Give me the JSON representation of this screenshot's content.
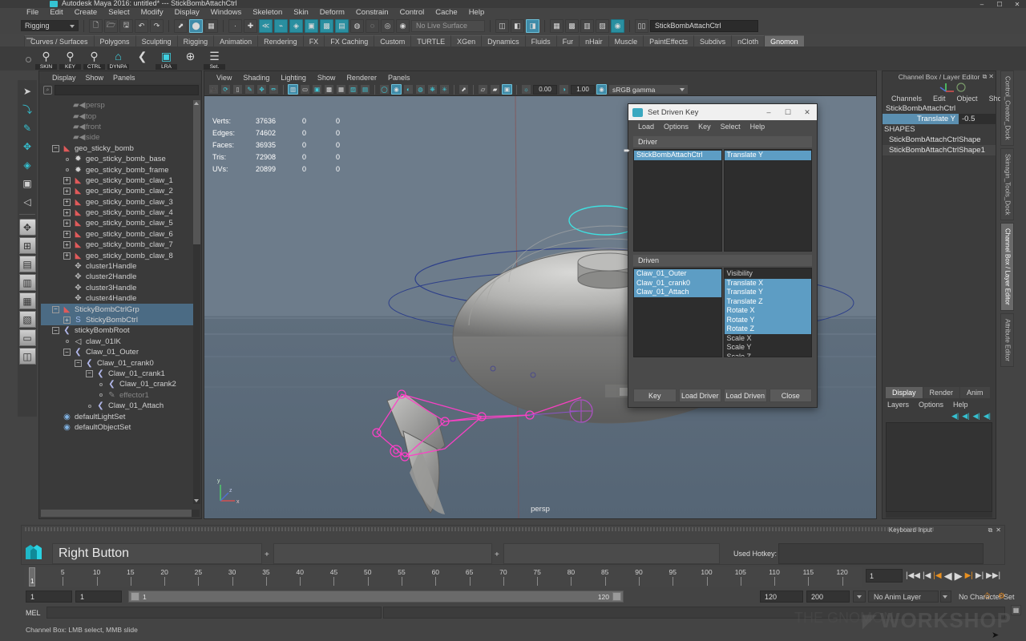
{
  "titlebar": {
    "title": "Autodesk Maya 2016: untitled* --- StickBombAttachCtrl",
    "minimize": "–",
    "maximize": "☐",
    "close": "✕"
  },
  "menubar": {
    "items": [
      "File",
      "Edit",
      "Create",
      "Select",
      "Modify",
      "Display",
      "Windows",
      "Skeleton",
      "Skin",
      "Deform",
      "Constrain",
      "Control",
      "Cache",
      "Help"
    ]
  },
  "statusline": {
    "menuset": "Rigging",
    "live_surface": "No Live Surface",
    "selected_name": "StickBombAttachCtrl",
    "icons": [
      "new-file-icon",
      "open-file-icon",
      "save-file-icon",
      "undo-icon",
      "redo-icon",
      "select-hierarchy-icon",
      "select-object-icon",
      "select-component-icon",
      "snap-grid-icon",
      "snap-curve-icon",
      "snap-point-icon",
      "snap-view-plane-icon",
      "construction-history-icon",
      "render-current-frame-icon",
      "render-sequence-icon",
      "ipr-render-icon",
      "render-settings-icon",
      "hypershade-icon",
      "show-channelbox-icon"
    ]
  },
  "shelf": {
    "tabs": [
      "Curves / Surfaces",
      "Polygons",
      "Sculpting",
      "Rigging",
      "Animation",
      "Rendering",
      "FX",
      "FX Caching",
      "Custom",
      "TURTLE",
      "XGen",
      "Dynamics",
      "Fluids",
      "Fur",
      "nHair",
      "Muscle",
      "PaintEffects",
      "Subdivs",
      "nCloth",
      "Gnomon"
    ],
    "active_tab": "Gnomon",
    "buttons": [
      {
        "label": "SKIN",
        "icon": "skin-tool-icon"
      },
      {
        "label": "KEY",
        "icon": "key-tool-icon"
      },
      {
        "label": "CTRL",
        "icon": "ctrl-tool-icon"
      },
      {
        "label": "DYNPA",
        "icon": "dynpa-tool-icon"
      },
      {
        "label": "",
        "icon": "joint-tool-icon"
      },
      {
        "label": "LRA",
        "icon": "lra-toggle-icon"
      },
      {
        "label": "",
        "icon": "move-pivot-icon"
      },
      {
        "label": "Set.",
        "icon": "settings-tool-icon"
      }
    ]
  },
  "toolbox": {
    "tools": [
      {
        "name": "select-tool",
        "glyph": "➤"
      },
      {
        "name": "lasso-select-tool",
        "glyph": "⤵"
      },
      {
        "name": "paint-select-tool",
        "glyph": "✎"
      },
      {
        "name": "move-tool",
        "glyph": "✥"
      },
      {
        "name": "rotate-tool",
        "glyph": "◈"
      },
      {
        "name": "scale-tool",
        "glyph": "▣"
      },
      {
        "name": "show-manipulator-tool",
        "glyph": "◁"
      }
    ],
    "layouts": [
      {
        "name": "single-perspective-layout",
        "glyph": "✥"
      },
      {
        "name": "four-view-layout",
        "glyph": "⊞"
      },
      {
        "name": "persp-outliner-layout",
        "glyph": "▤"
      },
      {
        "name": "two-pane-side-layout",
        "glyph": "▥"
      },
      {
        "name": "persp-graph-layout",
        "glyph": "▦"
      },
      {
        "name": "hypershade-persp-layout",
        "glyph": "▧"
      },
      {
        "name": "persp-render-layout",
        "glyph": "▭"
      },
      {
        "name": "outliner-persp-layout",
        "glyph": "◫"
      }
    ]
  },
  "outliner": {
    "menu": [
      "Display",
      "Show",
      "Panels"
    ],
    "search_placeholder": "",
    "search_value": "",
    "search_icon": "filter-icon",
    "items": [
      {
        "label": "persp",
        "indent": 2,
        "expander": "none",
        "icon": "camera-icon",
        "dim": true,
        "selected": false
      },
      {
        "label": "top",
        "indent": 2,
        "expander": "none",
        "icon": "camera-icon",
        "dim": true,
        "selected": false
      },
      {
        "label": "front",
        "indent": 2,
        "expander": "none",
        "icon": "camera-icon",
        "dim": true,
        "selected": false
      },
      {
        "label": "side",
        "indent": 2,
        "expander": "none",
        "icon": "camera-icon",
        "dim": true,
        "selected": false
      },
      {
        "label": "geo_sticky_bomb",
        "indent": 1,
        "expander": "minus",
        "icon": "mesh-icon",
        "dim": false,
        "selected": false
      },
      {
        "label": "geo_sticky_bomb_base",
        "indent": 2,
        "expander": "nub",
        "icon": "shape-icon",
        "dim": false,
        "selected": false
      },
      {
        "label": "geo_sticky_bomb_frame",
        "indent": 2,
        "expander": "nub",
        "icon": "shape-icon",
        "dim": false,
        "selected": false
      },
      {
        "label": "geo_sticky_bomb_claw_1",
        "indent": 2,
        "expander": "plus",
        "icon": "mesh-icon",
        "dim": false,
        "selected": false
      },
      {
        "label": "geo_sticky_bomb_claw_2",
        "indent": 2,
        "expander": "plus",
        "icon": "mesh-icon",
        "dim": false,
        "selected": false
      },
      {
        "label": "geo_sticky_bomb_claw_3",
        "indent": 2,
        "expander": "plus",
        "icon": "mesh-icon",
        "dim": false,
        "selected": false
      },
      {
        "label": "geo_sticky_bomb_claw_4",
        "indent": 2,
        "expander": "plus",
        "icon": "mesh-icon",
        "dim": false,
        "selected": false
      },
      {
        "label": "geo_sticky_bomb_claw_5",
        "indent": 2,
        "expander": "plus",
        "icon": "mesh-icon",
        "dim": false,
        "selected": false
      },
      {
        "label": "geo_sticky_bomb_claw_6",
        "indent": 2,
        "expander": "plus",
        "icon": "mesh-icon",
        "dim": false,
        "selected": false
      },
      {
        "label": "geo_sticky_bomb_claw_7",
        "indent": 2,
        "expander": "plus",
        "icon": "mesh-icon",
        "dim": false,
        "selected": false
      },
      {
        "label": "geo_sticky_bomb_claw_8",
        "indent": 2,
        "expander": "plus",
        "icon": "mesh-icon",
        "dim": false,
        "selected": false
      },
      {
        "label": "cluster1Handle",
        "indent": 2,
        "expander": "none",
        "icon": "cluster-icon",
        "dim": false,
        "selected": false
      },
      {
        "label": "cluster2Handle",
        "indent": 2,
        "expander": "none",
        "icon": "cluster-icon",
        "dim": false,
        "selected": false
      },
      {
        "label": "cluster3Handle",
        "indent": 2,
        "expander": "none",
        "icon": "cluster-icon",
        "dim": false,
        "selected": false
      },
      {
        "label": "cluster4Handle",
        "indent": 2,
        "expander": "none",
        "icon": "cluster-icon",
        "dim": false,
        "selected": false
      },
      {
        "label": "StickyBombCtrlGrp",
        "indent": 1,
        "expander": "minus",
        "icon": "mesh-icon",
        "dim": false,
        "selected": true
      },
      {
        "label": "StickyBombCtrl",
        "indent": 2,
        "expander": "plus",
        "icon": "curve-icon",
        "dim": false,
        "selected": true
      },
      {
        "label": "stickyBombRoot",
        "indent": 1,
        "expander": "minus",
        "icon": "joint-icon",
        "dim": false,
        "selected": false
      },
      {
        "label": "claw_01IK",
        "indent": 2,
        "expander": "nub",
        "icon": "ik-icon",
        "dim": false,
        "selected": false
      },
      {
        "label": "Claw_01_Outer",
        "indent": 2,
        "expander": "minus",
        "icon": "joint-icon",
        "dim": false,
        "selected": false
      },
      {
        "label": "Claw_01_crank0",
        "indent": 3,
        "expander": "minus",
        "icon": "joint-icon",
        "dim": false,
        "selected": false
      },
      {
        "label": "Claw_01_crank1",
        "indent": 4,
        "expander": "minus",
        "icon": "joint-icon",
        "dim": false,
        "selected": false
      },
      {
        "label": "Claw_01_crank2",
        "indent": 5,
        "expander": "nub",
        "icon": "joint-icon",
        "dim": false,
        "selected": false
      },
      {
        "label": "effector1",
        "indent": 5,
        "expander": "nub",
        "icon": "effector-icon",
        "dim": true,
        "selected": false
      },
      {
        "label": "Claw_01_Attach",
        "indent": 4,
        "expander": "nub",
        "icon": "joint-icon",
        "dim": false,
        "selected": false
      },
      {
        "label": "defaultLightSet",
        "indent": 1,
        "expander": "none",
        "icon": "set-icon",
        "dim": false,
        "selected": false
      },
      {
        "label": "defaultObjectSet",
        "indent": 1,
        "expander": "none",
        "icon": "set-icon",
        "dim": false,
        "selected": false
      }
    ]
  },
  "viewport": {
    "menu": [
      "View",
      "Shading",
      "Lighting",
      "Show",
      "Renderer",
      "Panels"
    ],
    "camera_label": "persp",
    "exposure": "0.00",
    "gamma": "1.00",
    "color_space": "sRGB gamma",
    "hud": {
      "rows": [
        {
          "label": "Verts:",
          "total": "37636",
          "col2": "0",
          "col3": "0"
        },
        {
          "label": "Edges:",
          "total": "74602",
          "col2": "0",
          "col3": "0"
        },
        {
          "label": "Faces:",
          "total": "36935",
          "col2": "0",
          "col3": "0"
        },
        {
          "label": "Tris:",
          "total": "72908",
          "col2": "0",
          "col3": "0"
        },
        {
          "label": "UVs:",
          "total": "20899",
          "col2": "0",
          "col3": "0"
        }
      ]
    },
    "axis_labels": {
      "x": "x",
      "y": "y",
      "z": "z"
    }
  },
  "set_driven_key": {
    "title": "Set Driven Key",
    "window_icon": "maya-window-icon",
    "minimize": "–",
    "maximize": "☐",
    "close": "✕",
    "menu": [
      "Load",
      "Options",
      "Key",
      "Select",
      "Help"
    ],
    "driver_section": "Driver",
    "driven_section": "Driven",
    "driver_objects": [
      {
        "label": "StickBombAttachCtrl",
        "selected": true
      }
    ],
    "driver_attrs": [
      {
        "label": "Translate Y",
        "selected": true
      }
    ],
    "driven_objects": [
      {
        "label": "Claw_01_Outer",
        "selected": true
      },
      {
        "label": "Claw_01_crank0",
        "selected": true
      },
      {
        "label": "Claw_01_Attach",
        "selected": true
      }
    ],
    "driven_attrs": [
      {
        "label": "Visibility",
        "selected": false
      },
      {
        "label": "Translate X",
        "selected": true
      },
      {
        "label": "Translate Y",
        "selected": true
      },
      {
        "label": "Translate Z",
        "selected": true
      },
      {
        "label": "Rotate X",
        "selected": true
      },
      {
        "label": "Rotate Y",
        "selected": true
      },
      {
        "label": "Rotate Z",
        "selected": true
      },
      {
        "label": "Scale X",
        "selected": false
      },
      {
        "label": "Scale Y",
        "selected": false
      },
      {
        "label": "Scale Z",
        "selected": false
      }
    ],
    "buttons": [
      "Key",
      "Load Driver",
      "Load Driven",
      "Close"
    ]
  },
  "channel_box": {
    "panel_title": "Channel Box / Layer Editor",
    "menu": [
      "Channels",
      "Edit",
      "Object",
      "Show"
    ],
    "object_name": "StickBombAttachCtrl",
    "channels": [
      {
        "attr": "Translate Y",
        "value": "-0.5"
      }
    ],
    "shapes_header": "SHAPES",
    "shapes": [
      "StickBombAttachCtrlShape",
      "StickBombAttachCtrlShape1"
    ],
    "layer_tabs": [
      "Display",
      "Render",
      "Anim"
    ],
    "active_layer_tab": "Display",
    "layer_menu": [
      "Layers",
      "Options",
      "Help"
    ],
    "layer_icons": [
      "layer-prev-icon",
      "layer-prev-fast-icon",
      "layer-next-icon",
      "layer-next-fast-icon"
    ]
  },
  "dock_tabs": {
    "items": [
      "Control_Creator_Dock",
      "Skinagin_Tools_Dock",
      "Channel Box / Layer Editor",
      "Attribute Editor"
    ],
    "active": "Channel Box / Layer Editor"
  },
  "hotkey_panel": {
    "caption": "Keyboard Input",
    "field1": "Right Button",
    "field2": "",
    "field3": "",
    "plus": "+",
    "used_hotkey_label": "Used Hotkey:",
    "used_hotkey_value": "",
    "float_icon": "float-panel-icon",
    "close_icon": "close-panel-icon"
  },
  "timeline": {
    "ticks": [
      "5",
      "10",
      "15",
      "20",
      "25",
      "30",
      "35",
      "40",
      "45",
      "50",
      "55",
      "60",
      "65",
      "70",
      "75",
      "80",
      "85",
      "90",
      "95",
      "100",
      "105",
      "110",
      "115",
      "120"
    ],
    "current_frame_marker": "1",
    "current_frame_field": "1",
    "playback_buttons": [
      "go-to-start-icon",
      "step-back-key-icon",
      "step-back-frame-icon",
      "play-backwards-icon",
      "play-forwards-icon",
      "step-forward-frame-icon",
      "step-forward-key-icon",
      "go-to-end-icon"
    ]
  },
  "range_bar": {
    "anim_start": "1",
    "range_start": "1",
    "slider_left_label": "1",
    "slider_right_label": "120",
    "range_end": "120",
    "anim_end": "200",
    "anim_layer": "No Anim Layer",
    "character_set": "No Character Set",
    "auto_key_icon": "auto-keyframe-icon",
    "prefs_icon": "animation-preferences-icon"
  },
  "command_line": {
    "label": "MEL",
    "input_value": "",
    "output_value": ""
  },
  "help_line": {
    "text": "Channel Box: LMB select, MMB slide",
    "subtext": ""
  },
  "watermark": {
    "text": "WORKSHOP",
    "secondary": "THE GNOMON",
    "icon": "gnomon-logo-icon"
  },
  "colors": {
    "accent_cyan": "#35c0d0",
    "selection_blue": "#5d9dc4",
    "outliner_selection": "#4b6b84",
    "channel_attr": "#5b8fb0",
    "window_bg": "#444444",
    "panel_bg": "#3c3c3c",
    "viewport_bg": "#6d7c8b",
    "orange_marker": "#e89020"
  }
}
